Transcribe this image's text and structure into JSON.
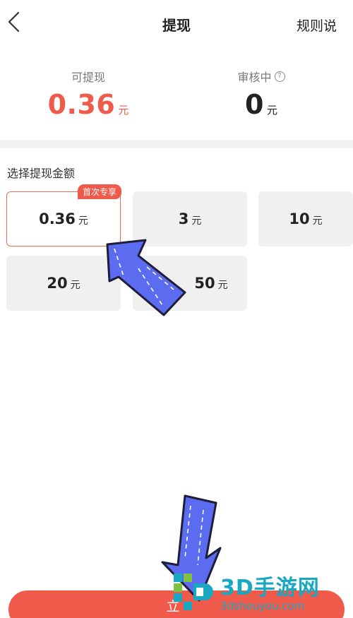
{
  "header": {
    "title": "提现",
    "rules_label": "规则说"
  },
  "summary": {
    "withdrawable_label": "可提现",
    "withdrawable_value": "0.36",
    "withdrawable_unit": "元",
    "reviewing_label": "审核中",
    "reviewing_value": "0",
    "reviewing_unit": "元"
  },
  "amount_section": {
    "label": "选择提现金额",
    "badge": "首次专享",
    "options": [
      {
        "value": "0.36",
        "unit": "元",
        "selected": true
      },
      {
        "value": "3",
        "unit": "元",
        "selected": false
      },
      {
        "value": "10",
        "unit": "元",
        "selected": false
      },
      {
        "value": "20",
        "unit": "元",
        "selected": false
      },
      {
        "value": "50",
        "unit": "元",
        "selected": false
      }
    ]
  },
  "submit_label": "立",
  "watermark": {
    "brand": "3D手游网",
    "domain": "3dshouyou.com"
  },
  "colors": {
    "accent_red": "#ef5a4a",
    "arrow_blue": "#5b6cf0",
    "watermark_teal": "#1aa7c2"
  }
}
